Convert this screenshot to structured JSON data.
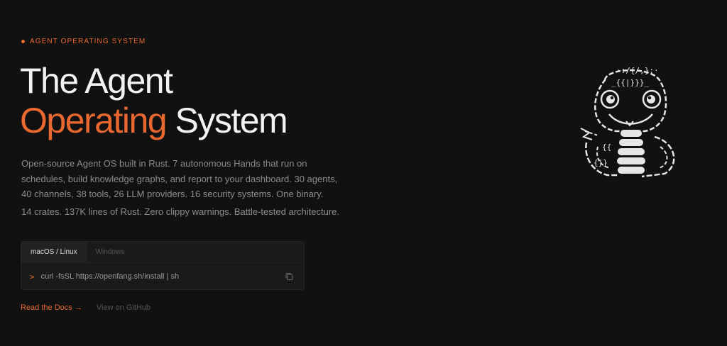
{
  "hero": {
    "eyebrow": "AGENT OPERATING SYSTEM",
    "title_line1": "The Agent",
    "title_accent": "Operating",
    "title_rest": " System",
    "description": "Open-source Agent OS built in Rust. 7 autonomous Hands that run on schedules, build knowledge graphs, and report to your dashboard. 30 agents, 40 channels, 38 tools, 26 LLM providers. 16 security systems. One binary.",
    "stats": "14 crates. 137K lines of Rust. Zero clippy warnings. Battle-tested architecture."
  },
  "install": {
    "tabs": [
      {
        "label": "macOS / Linux",
        "active": true
      },
      {
        "label": "Windows",
        "active": false
      }
    ],
    "prompt": ">",
    "command": "curl -fsSL https://openfang.sh/install | sh",
    "copy_icon": "copy-icon"
  },
  "links": {
    "docs": "Read the Docs →",
    "github": "View on GitHub"
  },
  "mascot": {
    "icon": "snake-mascot-icon",
    "glyphs_head": "·:/{/,}:·",
    "glyphs_brow": "_{{|}}}_",
    "glyphs_body": "{{",
    "glyphs_tail": "{}}"
  },
  "colors": {
    "accent": "#e8682f",
    "background": "#111111",
    "text": "#f2f2f2",
    "muted": "#8c8c8c"
  }
}
